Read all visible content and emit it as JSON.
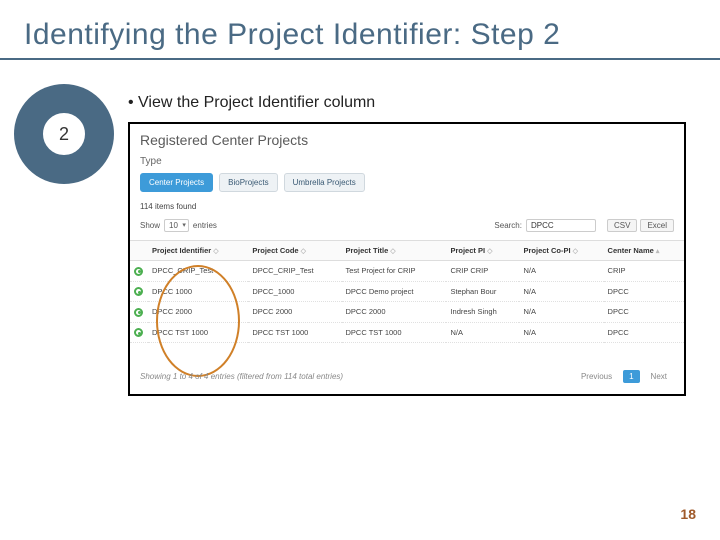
{
  "title": "Identifying the Project Identifier: Step 2",
  "step_number": "2",
  "bullet": "View the Project Identifier column",
  "page_number": "18",
  "screenshot": {
    "heading": "Registered Center Projects",
    "type_label": "Type",
    "tabs": [
      "Center Projects",
      "BioProjects",
      "Umbrella Projects"
    ],
    "items_found": "114 items found",
    "show_label": "Show",
    "show_value": "10",
    "entries_label": "entries",
    "search_label": "Search:",
    "search_value": "DPCC",
    "export_csv": "CSV",
    "export_excel": "Excel",
    "columns": [
      "",
      "Project Identifier",
      "Project Code",
      "Project Title",
      "Project PI",
      "Project Co-PI",
      "Center Name"
    ],
    "rows": [
      {
        "identifier": "DPCC_CRIP_Test",
        "code": "DPCC_CRIP_Test",
        "title": "Test Project for CRIP",
        "pi": "CRIP CRIP",
        "copi": "N/A",
        "center": "CRIP"
      },
      {
        "identifier": "DPCC 1000",
        "code": "DPCC_1000",
        "title": "DPCC Demo project",
        "pi": "Stephan Bour",
        "copi": "N/A",
        "center": "DPCC"
      },
      {
        "identifier": "DPCC 2000",
        "code": "DPCC 2000",
        "title": "DPCC 2000",
        "pi": "Indresh Singh",
        "copi": "N/A",
        "center": "DPCC"
      },
      {
        "identifier": "DPCC TST 1000",
        "code": "DPCC TST 1000",
        "title": "DPCC TST 1000",
        "pi": "N/A",
        "copi": "N/A",
        "center": "DPCC"
      }
    ],
    "footer_info": "Showing 1 to 4 of 4 entries (filtered from 114 total entries)",
    "prev": "Previous",
    "page": "1",
    "next": "Next"
  }
}
